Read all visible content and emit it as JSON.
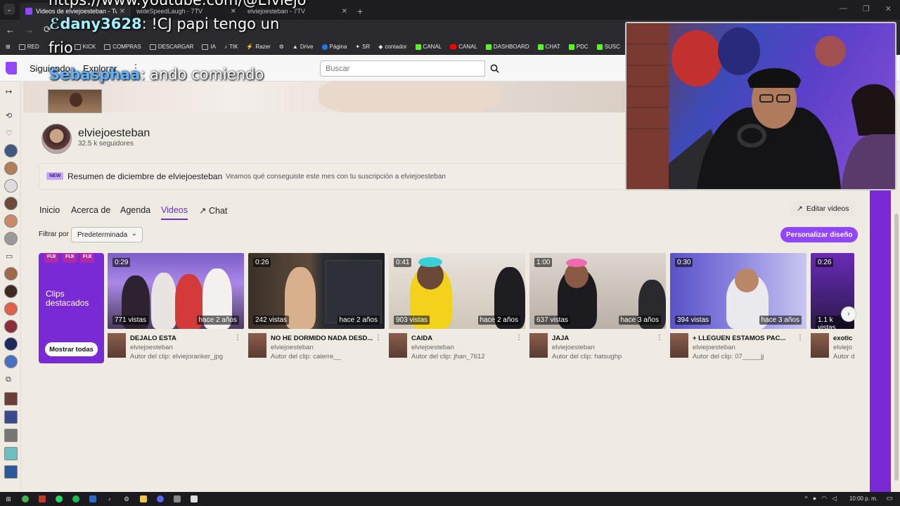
{
  "browser": {
    "tabs": [
      {
        "label": "Videos de elviejoesteban - Twitch",
        "active": true
      },
      {
        "label": "wideSpeedLaugh - 7TV",
        "active": false
      },
      {
        "label": "elviejoesteban - 7TV",
        "active": false
      }
    ],
    "bookmarks": [
      "RED",
      "KICK",
      "COMPRAS",
      "DESCARGAR",
      "IA",
      "TIK",
      "Razer",
      "",
      "Drive",
      "Página",
      "SR",
      "contador",
      "CANAL",
      "CANAL",
      "DASHBOARD",
      "CHAT",
      "PDC",
      "SUSC"
    ]
  },
  "twitch": {
    "nav_following": "Siguiendo",
    "nav_explore": "Explorar",
    "search_placeholder": "Buscar"
  },
  "channel": {
    "name": "elviejoesteban",
    "followers": "32.5 k seguidores",
    "recap_badge": "NEW",
    "recap_title": "Resumen de diciembre de elviejoesteban",
    "recap_sub": "Veamos qué conseguiste este mes con tu suscripción a elviejoesteban",
    "tabs": [
      "Inicio",
      "Acerca de",
      "Agenda",
      "Videos",
      "Chat"
    ],
    "edit_videos": "Editar videos",
    "filter_label": "Filtrar por",
    "filter_value": "Predeterminada",
    "customize": "Personalizar diseño"
  },
  "clips_card": {
    "title": "Clips destacados",
    "button": "Mostrar todas",
    "deco": "FIJI"
  },
  "clips": [
    {
      "duration": "0:29",
      "views": "771 vistas",
      "ago": "hace 2 años",
      "title": "DEJALO ESTA",
      "channel": "elviejoesteban",
      "author": "Autor del clip: elviejoranker_jpg"
    },
    {
      "duration": "0:26",
      "views": "242 vistas",
      "ago": "hace 2 años",
      "title": "NO HE DORMIDO NADA DESD...",
      "channel": "elviejoesteban",
      "author": "Autor del clip: calerre__"
    },
    {
      "duration": "0:41",
      "views": "903 vistas",
      "ago": "hace 2 años",
      "title": "CAIDA",
      "channel": "elviejoesteban",
      "author": "Autor del clip: jhan_7612"
    },
    {
      "duration": "1:00",
      "views": "637 vistas",
      "ago": "hace 3 años",
      "title": "JAJA",
      "channel": "elviejoesteban",
      "author": "Autor del clip: hatsughp"
    },
    {
      "duration": "0:30",
      "views": "394 vistas",
      "ago": "hace 3 años",
      "title": "+ LLEGUEN ESTAMOS PAC...",
      "channel": "elviejoesteban",
      "author": "Autor del clip: 07_____jj"
    },
    {
      "duration": "0:26",
      "views": "1.1 k vistas",
      "ago": "",
      "title": "exotic",
      "channel": "elviejo",
      "author": "Autor d"
    }
  ],
  "overlay": {
    "url": "https://www.youtube.com/@Elviejo",
    "msg1_user": "dany3628",
    "msg1_text": ": !CJ papi tengo un",
    "msg1_cont": "frio",
    "msg2_user": "Sebasphaa",
    "msg2_text": ": ando comiendo"
  },
  "taskbar": {
    "clock": "10:00 p. m."
  },
  "colors": {
    "accent": "#9146ff",
    "purple_dark": "#7a2ad4",
    "bg": "#efeae2"
  }
}
